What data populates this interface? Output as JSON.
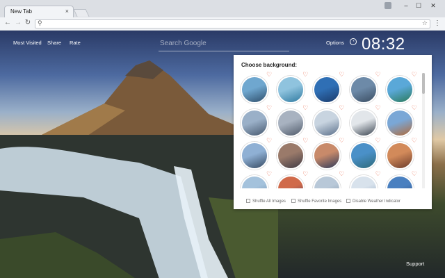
{
  "browser": {
    "tab_title": "New Tab",
    "tab_close": "×",
    "window_controls": {
      "minimize": "–",
      "maximize": "☐",
      "close": "✕"
    },
    "nav": {
      "back": "←",
      "forward": "→",
      "reload": "↻"
    },
    "omnibox_value": "",
    "menu": "⋮"
  },
  "page": {
    "links": {
      "most_visited": "Most Visited",
      "share": "Share",
      "rate": "Rate"
    },
    "search_placeholder": "Search Google",
    "options": "Options",
    "clock": "08:32",
    "support": "Support"
  },
  "panel": {
    "title": "Choose background:",
    "heart_glyph": "♡",
    "thumbnails": [
      {
        "c1": "#6fa7cf",
        "c2": "#2e4e6b"
      },
      {
        "c1": "#8fc3de",
        "c2": "#2f7aa0"
      },
      {
        "c1": "#2f6fb5",
        "c2": "#1a3a6a"
      },
      {
        "c1": "#6d8aa8",
        "c2": "#3a4d62"
      },
      {
        "c1": "#5aa8d8",
        "c2": "#2a7a5a"
      },
      {
        "c1": "#9ab0c8",
        "c2": "#46586e"
      },
      {
        "c1": "#a8b2c0",
        "c2": "#4f5a6a"
      },
      {
        "c1": "#c8d4e0",
        "c2": "#5a6f8a"
      },
      {
        "c1": "#e2e6ea",
        "c2": "#3a4450"
      },
      {
        "c1": "#7aa7d6",
        "c2": "#b06a3a"
      },
      {
        "c1": "#8fb0d4",
        "c2": "#364a62"
      },
      {
        "c1": "#9a7a6a",
        "c2": "#3f3a44"
      },
      {
        "c1": "#c88a6a",
        "c2": "#2e3a5a"
      },
      {
        "c1": "#4a90c8",
        "c2": "#2e6a7a"
      },
      {
        "c1": "#d28a5a",
        "c2": "#6a3a2a"
      },
      {
        "c1": "#a4c2dc",
        "c2": "#6a8aa8"
      },
      {
        "c1": "#d06a4a",
        "c2": "#4a3a5a"
      },
      {
        "c1": "#b8c8d8",
        "c2": "#7a8ea2"
      },
      {
        "c1": "#d8e2ec",
        "c2": "#8aa2ba"
      },
      {
        "c1": "#4a80c0",
        "c2": "#2a4a7a"
      }
    ],
    "checkboxes": [
      {
        "label": "Shuffle All Images"
      },
      {
        "label": "Shuffle Favorite Images"
      },
      {
        "label": "Disable Weather Indicator"
      }
    ]
  }
}
